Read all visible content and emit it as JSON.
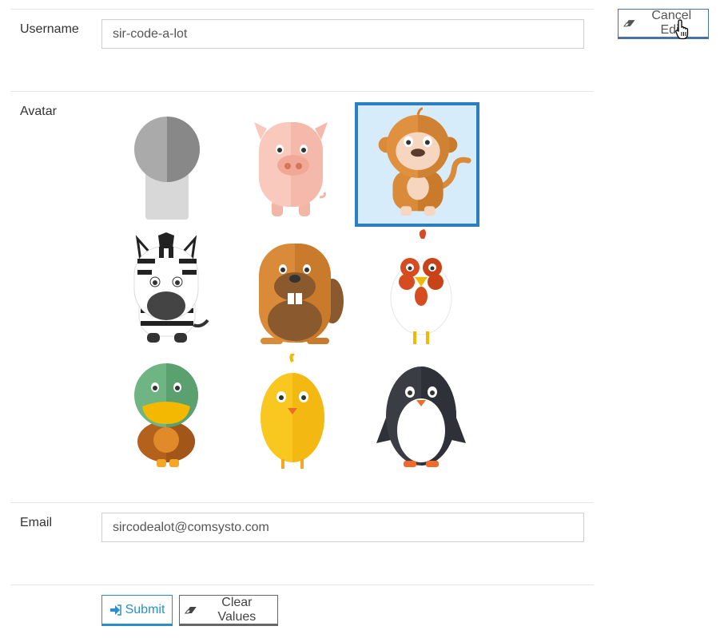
{
  "form": {
    "username": {
      "label": "Username",
      "value": "sir-code-a-lot"
    },
    "avatar": {
      "label": "Avatar",
      "options": [
        "default",
        "pig",
        "monkey",
        "zebra",
        "beaver",
        "rooster",
        "duck",
        "chick",
        "penguin"
      ],
      "selected": "monkey"
    },
    "email": {
      "label": "Email",
      "value": "sircodealot@comsysto.com"
    }
  },
  "buttons": {
    "cancel_edit": "Cancel Edit",
    "submit": "Submit",
    "clear_values": "Clear Values"
  },
  "colors": {
    "primary": "#2a8fc8",
    "selected_border": "#2a7fc0",
    "selected_bg": "#d6ecfb",
    "cancel_border": "#4a6fa5"
  }
}
